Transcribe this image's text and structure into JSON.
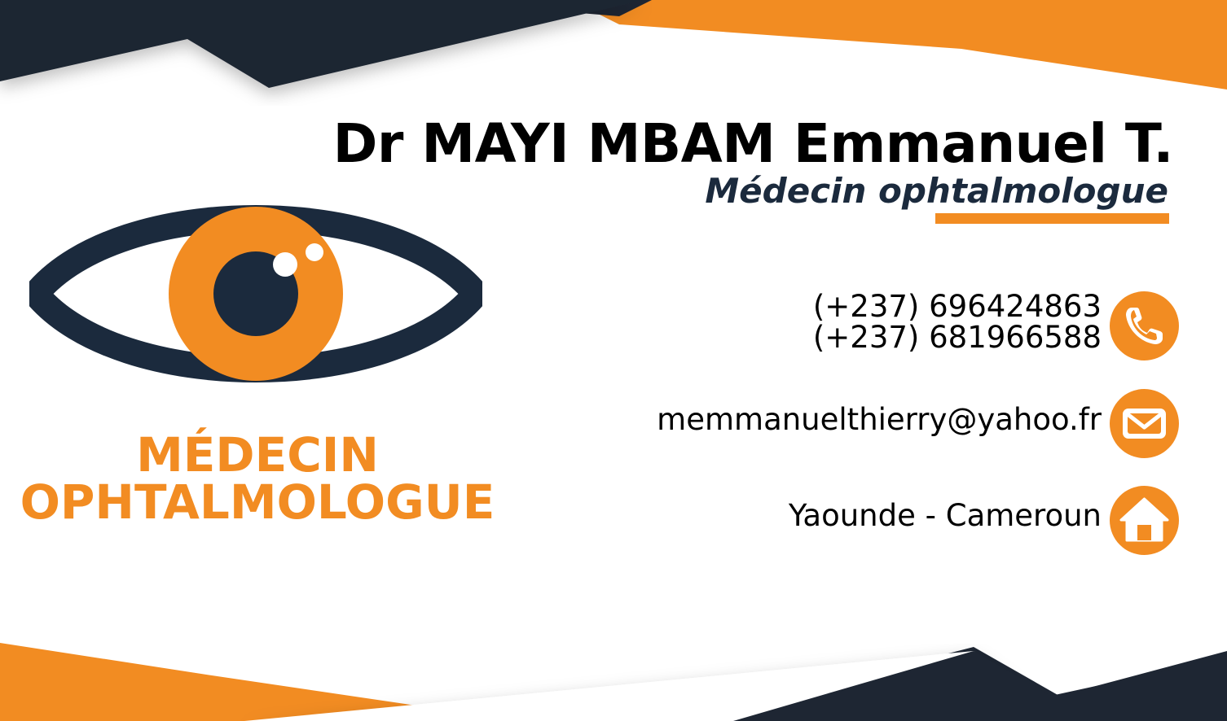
{
  "card": {
    "name": "Dr MAYI MBAM Emmanuel T.",
    "title": "Médecin ophtalmologue",
    "phone_1": "(+237) 696424863",
    "phone_2": "(+237) 681966588",
    "email": "memmanuelthierry@yahoo.fr",
    "address": "Yaounde - Cameroun",
    "specialty_line_1": "MÉDECIN",
    "specialty_line_2": "OPHTALMOLOGUE"
  },
  "icons": [
    "eye-logo-icon",
    "phone-icon",
    "mail-icon",
    "home-icon"
  ],
  "colors": {
    "accent": "#f28c22",
    "dark": "#1b2a3d",
    "text": "#000000",
    "background": "#ffffff"
  }
}
